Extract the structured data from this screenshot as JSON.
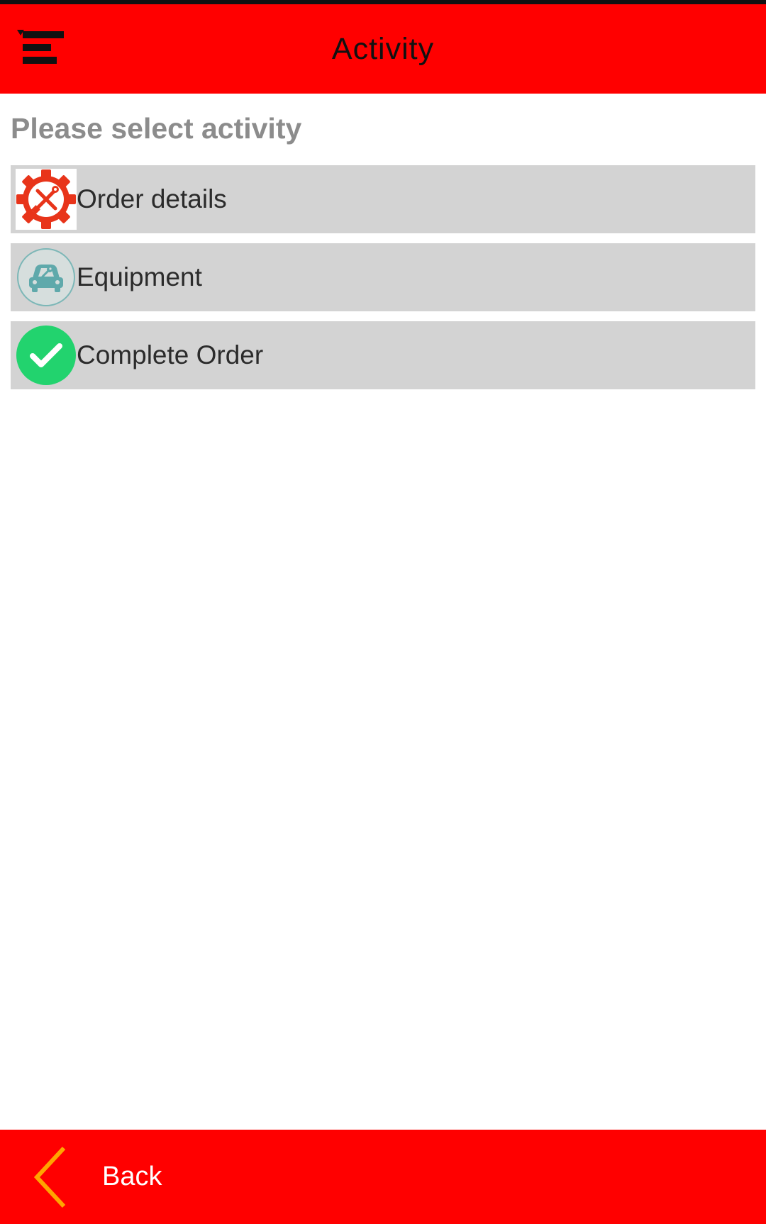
{
  "header": {
    "title": "Activity",
    "menu_icon": "menu-icon",
    "background_color": "#ff0000"
  },
  "prompt": "Please select activity",
  "activities": [
    {
      "label": "Order details",
      "icon": "gear-tools-icon"
    },
    {
      "label": "Equipment",
      "icon": "car-wrench-icon"
    },
    {
      "label": "Complete Order",
      "icon": "check-circle-icon"
    }
  ],
  "footer": {
    "back_label": "Back",
    "back_icon": "chevron-left-icon",
    "background_color": "#ff0000",
    "chevron_color": "#ffa500"
  }
}
